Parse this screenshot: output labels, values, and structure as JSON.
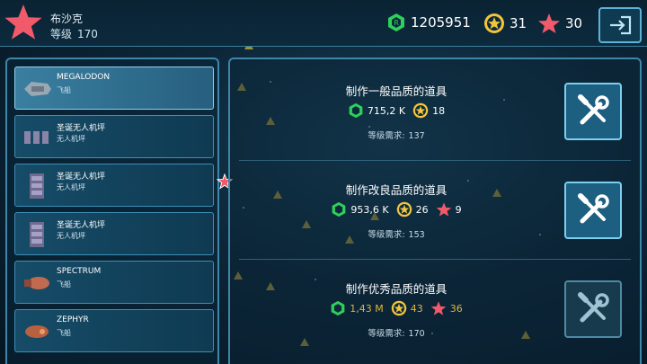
{
  "player": {
    "name": "布沙克",
    "level_label": "等级",
    "level": "170"
  },
  "currencies": {
    "credits": "1205951",
    "gold_stars": "31",
    "red_stars": "30"
  },
  "colors": {
    "credit_green": "#2fcf5a",
    "gold_star": "#f2c53a",
    "red_star": "#f05a6a",
    "accent_blue": "#5fb2d6"
  },
  "icons": {
    "exit": "exit-icon",
    "craft": "wrench-screwdriver-icon",
    "credit": "credit-icon",
    "gold_star": "gold-star-icon",
    "red_star": "red-star-icon"
  },
  "items": [
    {
      "name": "MEGALODON",
      "type": "飞船",
      "icon": "ship-icon",
      "selected": true
    },
    {
      "name": "圣诞无人机坪",
      "type": "无人机坪",
      "icon": "drone-pad-icon",
      "selected": false
    },
    {
      "name": "圣诞无人机坪",
      "type": "无人机坪",
      "icon": "drone-pad-icon",
      "selected": false
    },
    {
      "name": "圣诞无人机坪",
      "type": "无人机坪",
      "icon": "drone-pad-icon",
      "selected": false
    },
    {
      "name": "SPECTRUM",
      "type": "飞船",
      "icon": "ship-icon",
      "selected": false
    },
    {
      "name": "ZEPHYR",
      "type": "飞船",
      "icon": "ship-icon",
      "selected": false
    }
  ],
  "crafting": [
    {
      "title": "制作一般品质的道具",
      "credits": "715,2 K",
      "gold_stars": "18",
      "red_stars": "",
      "req_label": "等级需求:",
      "req_level": "137",
      "enabled": true
    },
    {
      "title": "制作改良品质的道具",
      "credits": "953,6 K",
      "gold_stars": "26",
      "red_stars": "9",
      "req_label": "等级需求:",
      "req_level": "153",
      "enabled": true
    },
    {
      "title": "制作优秀品质的道具",
      "credits": "1,43 M",
      "gold_stars": "43",
      "red_stars": "36",
      "req_label": "等级需求:",
      "req_level": "170",
      "enabled": false
    }
  ]
}
